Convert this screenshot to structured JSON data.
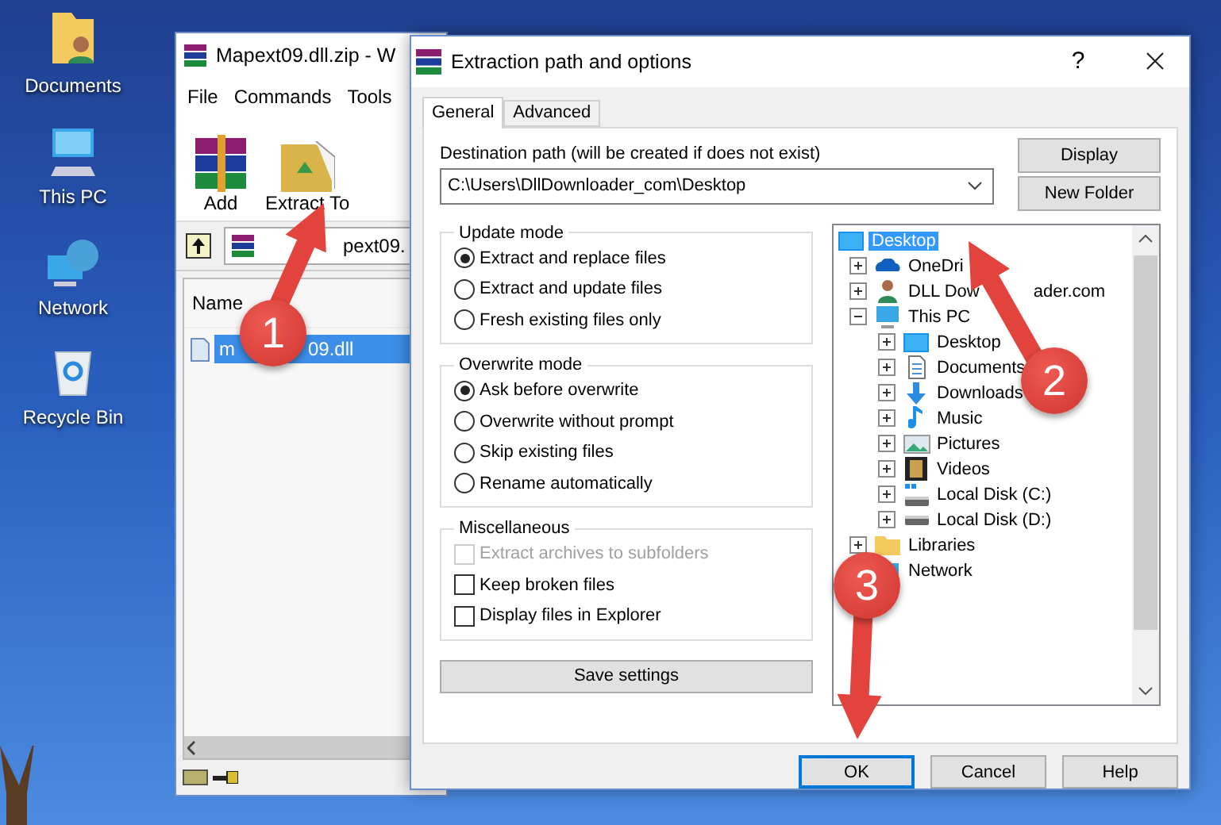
{
  "desktop_icons": [
    {
      "label": "Documents",
      "kind": "folder-user"
    },
    {
      "label": "This PC",
      "kind": "computer"
    },
    {
      "label": "Network",
      "kind": "network"
    },
    {
      "label": "Recycle Bin",
      "kind": "recycle"
    }
  ],
  "archive_window": {
    "title": "Mapext09.dll.zip - W",
    "menu": [
      "File",
      "Commands",
      "Tools"
    ],
    "toolbar": [
      {
        "label": "Add",
        "kind": "add"
      },
      {
        "label": "Extract To",
        "kind": "extract"
      }
    ],
    "address": "pext09.",
    "columns": [
      "Name"
    ],
    "files": [
      {
        "name_parts": [
          "m",
          "09.dll"
        ],
        "selected": true
      }
    ]
  },
  "dialog": {
    "title": "Extraction path and options",
    "help": "?",
    "tabs": [
      {
        "label": "General",
        "selected": true
      },
      {
        "label": "Advanced",
        "selected": false
      }
    ],
    "destination_label": "Destination path (will be created if does not exist)",
    "destination_path": "C:\\Users\\DllDownloader_com\\Desktop",
    "side_buttons": [
      "Display",
      "New Folder"
    ],
    "groups": [
      {
        "title": "Update mode",
        "options": [
          {
            "label": "Extract and replace files",
            "kind": "radio",
            "selected": true,
            "disabled": false
          },
          {
            "label": "Extract and update files",
            "kind": "radio",
            "selected": false,
            "disabled": false
          },
          {
            "label": "Fresh existing files only",
            "kind": "radio",
            "selected": false,
            "disabled": false
          }
        ]
      },
      {
        "title": "Overwrite mode",
        "options": [
          {
            "label": "Ask before overwrite",
            "kind": "radio",
            "selected": true,
            "disabled": false
          },
          {
            "label": "Overwrite without prompt",
            "kind": "radio",
            "selected": false,
            "disabled": false
          },
          {
            "label": "Skip existing files",
            "kind": "radio",
            "selected": false,
            "disabled": false
          },
          {
            "label": "Rename automatically",
            "kind": "radio",
            "selected": false,
            "disabled": false
          }
        ]
      },
      {
        "title": "Miscellaneous",
        "options": [
          {
            "label": "Extract archives to subfolders",
            "kind": "checkbox",
            "selected": false,
            "disabled": true
          },
          {
            "label": "Keep broken files",
            "kind": "checkbox",
            "selected": false,
            "disabled": false
          },
          {
            "label": "Display files in Explorer",
            "kind": "checkbox",
            "selected": false,
            "disabled": false
          }
        ]
      }
    ],
    "save_button": "Save settings",
    "tree": [
      {
        "label_parts": [
          "Desktop"
        ],
        "kind": "monitor",
        "selected": true,
        "children": [
          {
            "label_parts": [
              "OneDri"
            ],
            "kind": "cloud",
            "selected": false,
            "expanded": false
          },
          {
            "label_parts": [
              "DLL Dow",
              "ader.com"
            ],
            "kind": "user",
            "selected": false,
            "expanded": false
          },
          {
            "label_parts": [
              "This PC"
            ],
            "kind": "computer",
            "selected": false,
            "expanded": true,
            "children": [
              {
                "label_parts": [
                  "Desktop"
                ],
                "kind": "monitor",
                "selected": false,
                "expanded": false
              },
              {
                "label_parts": [
                  "Documents"
                ],
                "kind": "document",
                "selected": false,
                "expanded": false
              },
              {
                "label_parts": [
                  "Downloads"
                ],
                "kind": "download",
                "selected": false,
                "expanded": false
              },
              {
                "label_parts": [
                  "Music"
                ],
                "kind": "music",
                "selected": false,
                "expanded": false
              },
              {
                "label_parts": [
                  "Pictures"
                ],
                "kind": "picture",
                "selected": false,
                "expanded": false
              },
              {
                "label_parts": [
                  "Videos"
                ],
                "kind": "video",
                "selected": false,
                "expanded": false
              },
              {
                "label_parts": [
                  "Local Disk (C:)"
                ],
                "kind": "disk-win",
                "selected": false,
                "expanded": false
              },
              {
                "label_parts": [
                  "Local Disk (D:)"
                ],
                "kind": "disk",
                "selected": false,
                "expanded": false
              }
            ]
          },
          {
            "label_parts": [
              "Libraries"
            ],
            "kind": "folder",
            "selected": false,
            "expanded": false
          },
          {
            "label_parts": [
              "Network"
            ],
            "kind": "network",
            "selected": false
          }
        ]
      }
    ],
    "buttons": [
      {
        "label": "OK",
        "focused": true
      },
      {
        "label": "Cancel",
        "focused": false
      },
      {
        "label": "Help",
        "focused": false
      }
    ]
  },
  "annotations": [
    {
      "number": "1"
    },
    {
      "number": "2"
    },
    {
      "number": "3"
    }
  ]
}
